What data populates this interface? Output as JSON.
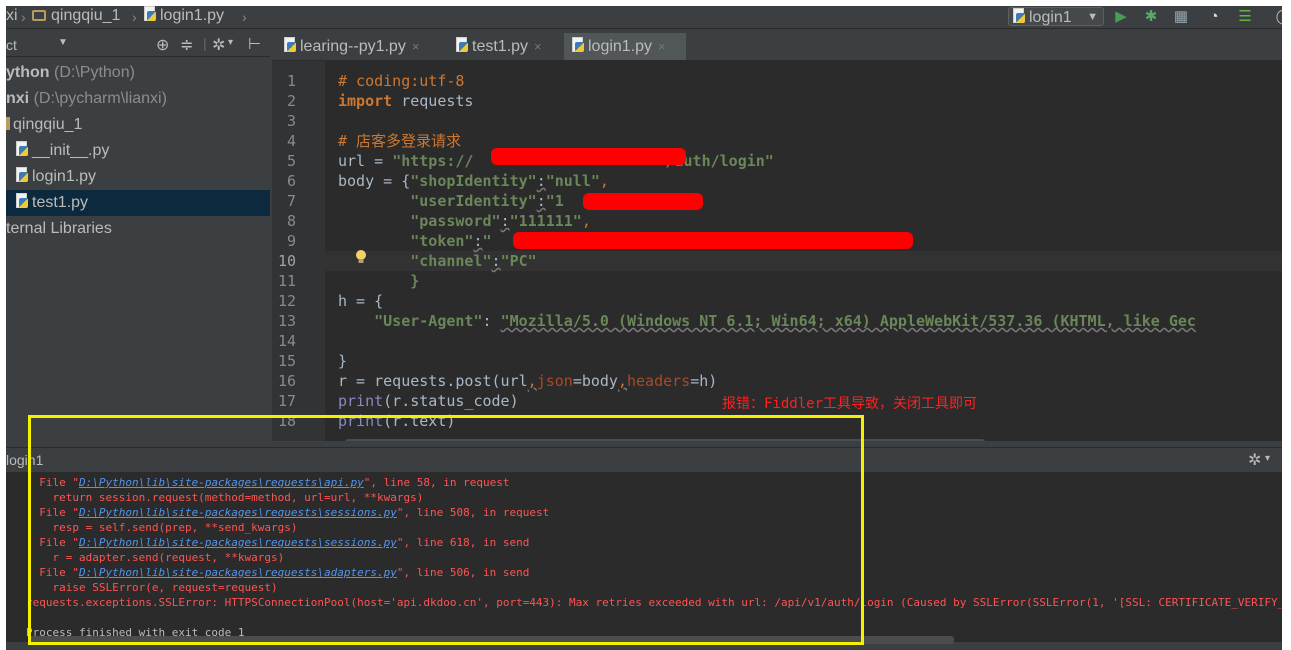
{
  "breadcrumb": {
    "root": "xi",
    "project": "qingqiu_1",
    "file": "login1.py"
  },
  "toolbar": {
    "run_config": "login1",
    "run_icon": "play-icon",
    "debug_icon": "bug-icon",
    "coverage_icon": "coverage-icon",
    "profile_icon": "profile-icon",
    "concurrency_icon": "concurrency-icon"
  },
  "project_panel": {
    "view_label": "ct",
    "items": [
      {
        "label": "ython",
        "path": "(D:\\Python)"
      },
      {
        "label": "nxi",
        "path": "(D:\\pycharm\\lianxi)"
      },
      {
        "label": "qingqiu_1",
        "path": ""
      },
      {
        "label": "__init__.py",
        "path": ""
      },
      {
        "label": "login1.py",
        "path": ""
      },
      {
        "label": "test1.py",
        "path": ""
      },
      {
        "label": "ternal Libraries",
        "path": ""
      }
    ]
  },
  "tabs": [
    {
      "label": "learing--py1.py",
      "close": "×"
    },
    {
      "label": "test1.py",
      "close": "×"
    },
    {
      "label": "login1.py",
      "close": "×"
    }
  ],
  "editor": {
    "line_numbers": [
      "1",
      "2",
      "3",
      "4",
      "5",
      "6",
      "7",
      "8",
      "9",
      "10",
      "11",
      "12",
      "13",
      "14",
      "15",
      "16",
      "17",
      "18"
    ],
    "current_line": "10",
    "lines": {
      "l1": "# coding:utf-8",
      "l2_kw": "import",
      "l2_rest": " requests",
      "l4": "# 店客多登录请求",
      "l5_a": "url = ",
      "l5_b": "\"https://",
      "l5_c": "/auth/login\"",
      "l6_a": "body = {",
      "l6_b": "\"shopIdentity\"",
      "l6_c": ":",
      "l6_d": "\"null\"",
      "l6_e": ",",
      "l7_a": "        ",
      "l7_b": "\"userIdentity\"",
      "l7_c": ":",
      "l7_d": "\"1",
      "l7_e": ",",
      "l8_b": "\"password\"",
      "l8_c": ":",
      "l8_d": "\"111111\"",
      "l8_e": ",",
      "l9_b": "\"token\"",
      "l9_c": ":",
      "l9_d": "\"",
      "l9_e": "\",",
      "l10_b": "\"channel\"",
      "l10_c": ":",
      "l10_d": "\"PC\"",
      "l11": "        }",
      "l12": "h = {",
      "l13_a": "    ",
      "l13_b": "\"User-Agent\"",
      "l13_c": ": ",
      "l13_d": "\"Mozilla/5.0 (Windows NT 6.1; Win64; x64) AppleWebKit/537.36 (KHTML, like Gec",
      "l15": "}",
      "l16_a": "r = requests.post(url",
      "l16_b": ",",
      "l16_c": "json",
      "l16_d": "=body",
      "l16_e": ",",
      "l16_f": "headers",
      "l16_g": "=h)",
      "l17_a": "print",
      "l17_b": "(r.status_code)",
      "l18_a": "print",
      "l18_b": "(r.text)"
    }
  },
  "annotation": "报错：Fiddler工具导致，关闭工具即可",
  "run_panel": {
    "title": "login1",
    "settings_icon": "gear-icon"
  },
  "console": {
    "f1_pre": "  File \"",
    "f1_link": "D:\\Python\\lib\\site-packages\\requests\\api.py",
    "f1_post": "\", line 58, in request",
    "r1": "    return session.request(method=method, url=url, **kwargs)",
    "f2_pre": "  File \"",
    "f2_link": "D:\\Python\\lib\\site-packages\\requests\\sessions.py",
    "f2_post": "\", line 508, in request",
    "r2": "    resp = self.send(prep, **send_kwargs)",
    "f3_pre": "  File \"",
    "f3_link": "D:\\Python\\lib\\site-packages\\requests\\sessions.py",
    "f3_post": "\", line 618, in send",
    "r3": "    r = adapter.send(request, **kwargs)",
    "f4_pre": "  File \"",
    "f4_link": "D:\\Python\\lib\\site-packages\\requests\\adapters.py",
    "f4_post": "\", line 506, in send",
    "r4": "    raise SSLError(e, request=request)",
    "err": "requests.exceptions.SSLError: HTTPSConnectionPool(host='api.dkdoo.cn', port=443): Max retries exceeded with url: /api/v1/auth/login (Caused by SSLError(SSLError(1, '[SSL: CERTIFICATE_VERIFY_FAILED]",
    "done": "Process finished with exit code 1"
  },
  "colors": {
    "highlight_box": "#f3f000",
    "redaction": "#ff0000",
    "error_text": "#ff5353"
  }
}
